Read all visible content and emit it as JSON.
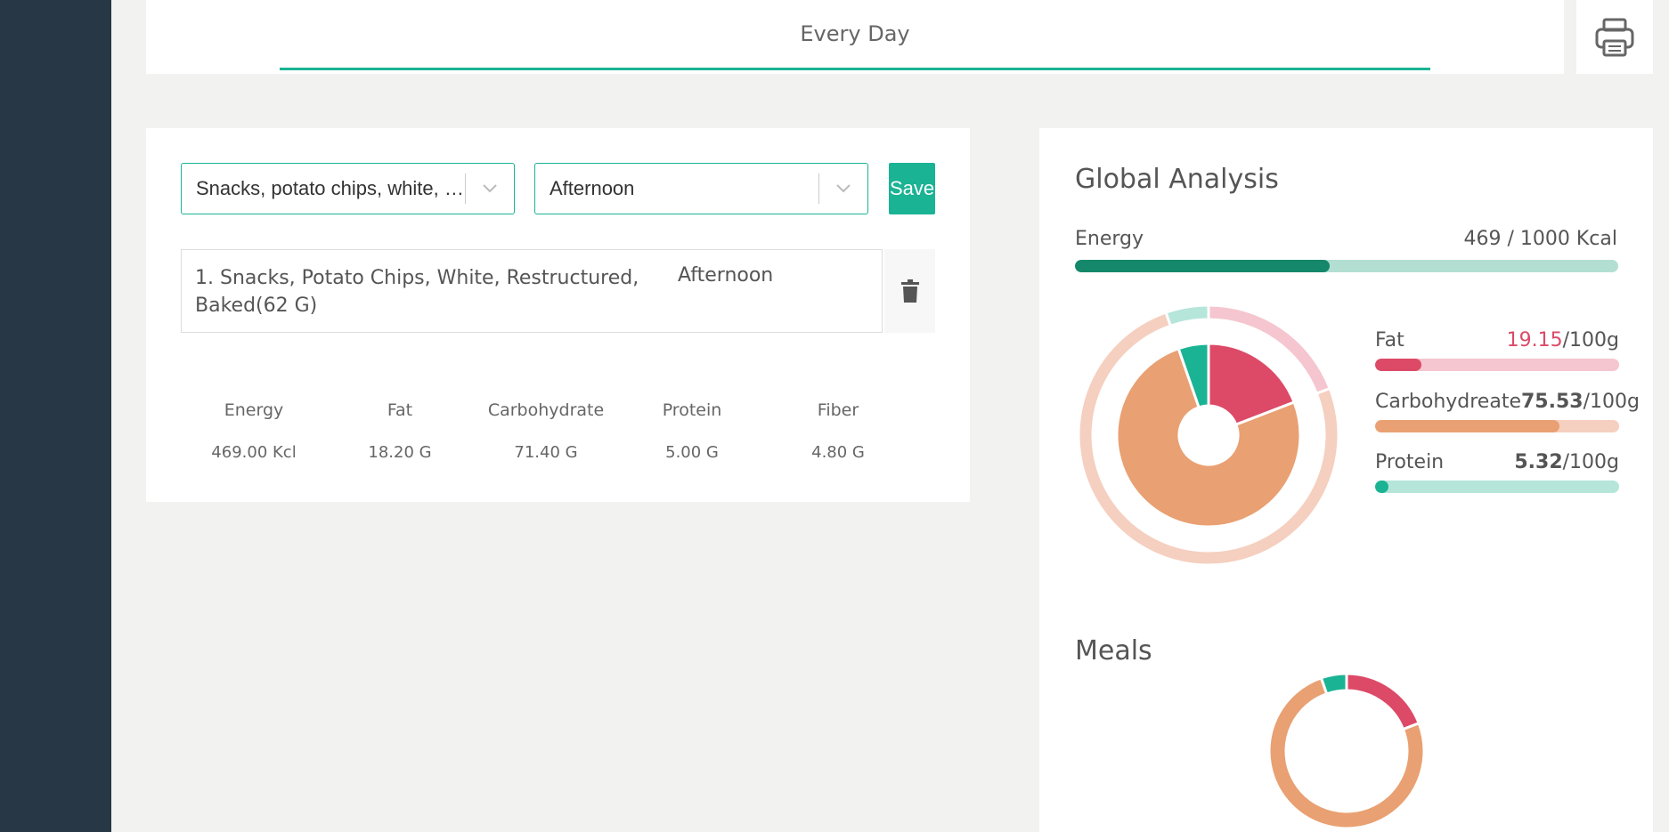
{
  "header": {
    "tab_label": "Every Day"
  },
  "form": {
    "food_select": "Snacks, potato chips, white, restructured, baked",
    "time_select": "Afternoon",
    "save_label": "Save"
  },
  "entries": [
    {
      "name": "1. Snacks, Potato Chips, White, Restructured, Baked(62 G)",
      "time": "Afternoon"
    }
  ],
  "nutrition": [
    {
      "label": "Energy",
      "value": "469.00 Kcl"
    },
    {
      "label": "Fat",
      "value": "18.20 G"
    },
    {
      "label": "Carbohydrate",
      "value": "71.40 G"
    },
    {
      "label": "Protein",
      "value": "5.00 G"
    },
    {
      "label": "Fiber",
      "value": "4.80 G"
    }
  ],
  "analysis": {
    "title": "Global Analysis",
    "energy": {
      "label": "Energy",
      "value_text": "469 / 1000 Kcal",
      "fraction": 0.469
    },
    "macros": [
      {
        "label": "Fat",
        "value": "19.15",
        "unit": "/100g",
        "fraction": 0.19,
        "color": "#dc4a67",
        "track": "#f5c6cf"
      },
      {
        "label": "Carbohydreate",
        "value": "75.53",
        "unit": "/100g",
        "fraction": 0.755,
        "color": "#e9a072",
        "track": "#f5cfbf"
      },
      {
        "label": "Protein",
        "value": "5.32",
        "unit": "/100g",
        "fraction": 0.053,
        "color": "#1ab394",
        "track": "#b6e5da"
      }
    ]
  },
  "meals": {
    "title": "Meals"
  },
  "colors": {
    "accent": "#1ab394",
    "sidebar": "#283746",
    "fat": "#dc4a67",
    "carb": "#e9a072",
    "protein": "#1ab394"
  },
  "icons": {
    "print": "printer-icon",
    "delete": "trash-icon",
    "dropdown": "chevron-down-icon"
  }
}
